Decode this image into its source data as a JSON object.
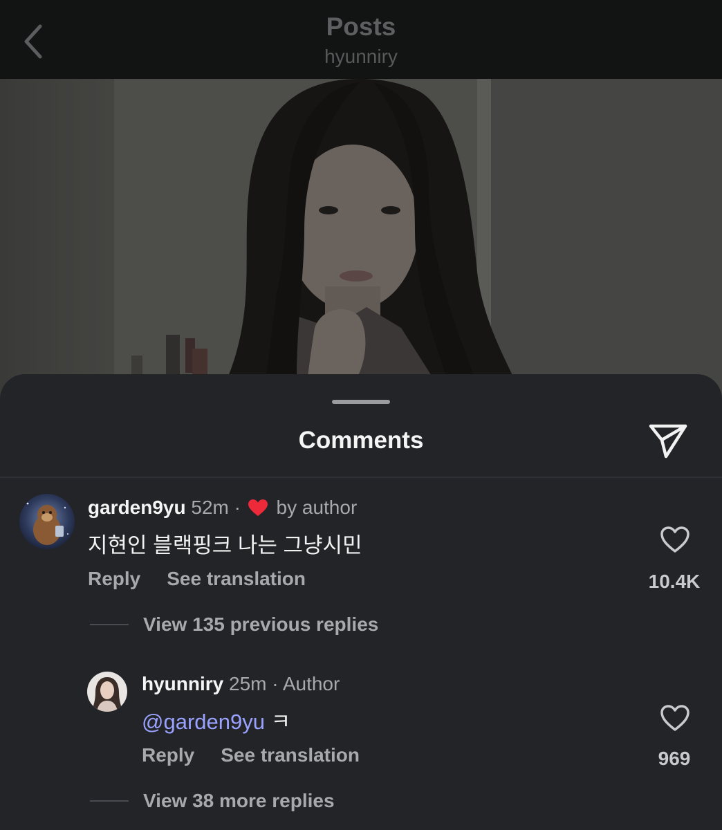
{
  "header": {
    "title": "Posts",
    "subtitle": "hyunniry"
  },
  "sheet": {
    "title": "Comments"
  },
  "comments": [
    {
      "username": "garden9yu",
      "time": "52m",
      "separator": "·",
      "liked_by": "by author",
      "text": "지현인 블랙핑크 나는 그냥시민",
      "reply_label": "Reply",
      "translate_label": "See translation",
      "likes": "10.4K",
      "view_replies": "View 135 previous replies"
    },
    {
      "username": "hyunniry",
      "time": "25m",
      "separator": "·",
      "badge": "Author",
      "mention": "@garden9yu",
      "text": "ㅋ",
      "reply_label": "Reply",
      "translate_label": "See translation",
      "likes": "969",
      "view_replies": "View 38 more replies"
    }
  ],
  "colors": {
    "sheet_bg": "#232428",
    "mention": "#9aa2ff",
    "heart": "#ed2a3a"
  },
  "icons": [
    "chevron-left-icon",
    "share-send-icon",
    "heart-outline-icon",
    "heart-filled-icon"
  ]
}
